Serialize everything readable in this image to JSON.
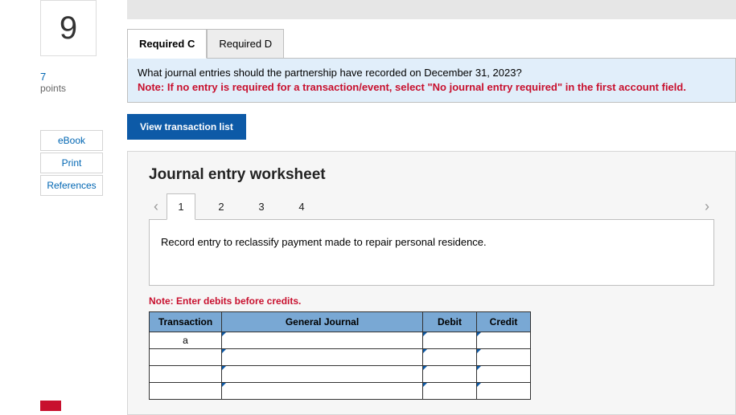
{
  "question": {
    "number": "9",
    "points_value": "7",
    "points_label": "points"
  },
  "side_links": {
    "ebook": "eBook",
    "print": "Print",
    "references": "References"
  },
  "req_tabs": {
    "c": "Required C",
    "d": "Required D"
  },
  "instruction": {
    "question": "What journal entries should the partnership have recorded on December 31, 2023?",
    "note": "Note: If no entry is required for a transaction/event, select \"No journal entry required\" in the first account field."
  },
  "buttons": {
    "view_list": "View transaction list"
  },
  "worksheet": {
    "title": "Journal entry worksheet",
    "pages": {
      "p1": "1",
      "p2": "2",
      "p3": "3",
      "p4": "4"
    },
    "description": "Record entry to reclassify payment made to repair personal residence.",
    "debit_note": "Note: Enter debits before credits.",
    "headers": {
      "transaction": "Transaction",
      "general_journal": "General Journal",
      "debit": "Debit",
      "credit": "Credit"
    },
    "rows": {
      "r1_trans": "a"
    }
  }
}
